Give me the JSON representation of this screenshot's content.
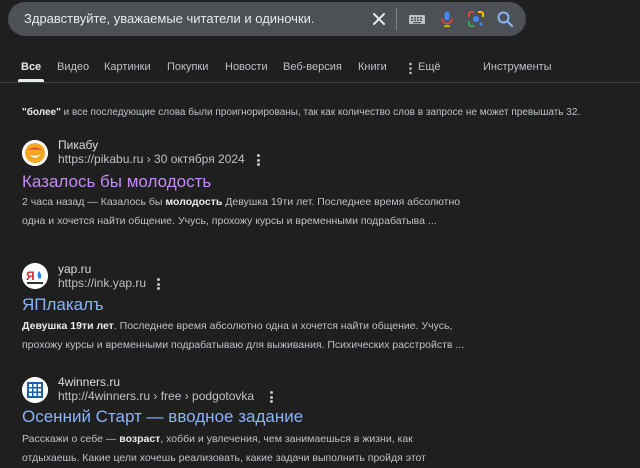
{
  "search": {
    "query": "Здравствуйте, уважаемые читатели и одиночки."
  },
  "icons": {
    "clear": "close-icon",
    "keyboard": "keyboard-icon",
    "mic": "microphone-icon",
    "lens": "lens-icon",
    "search": "search-icon"
  },
  "tabs": [
    {
      "label": "Все",
      "active": true
    },
    {
      "label": "Видео"
    },
    {
      "label": "Картинки"
    },
    {
      "label": "Покупки"
    },
    {
      "label": "Новости"
    },
    {
      "label": "Веб-версия"
    },
    {
      "label": "Книги"
    },
    {
      "label": "Ещё"
    },
    {
      "label": "Инструменты"
    }
  ],
  "notice": {
    "word": "\"более\"",
    "text": " и все последующие слова были проигнорированы, так как количество слов в запросе не может превышать 32."
  },
  "results": [
    {
      "site": "Пикабу",
      "url": "https://pikabu.ru › 30 октября 2024",
      "title": "Казалось бы молодость",
      "snippet_lines": [
        {
          "pre": "2 часа назад — Казалось бы ",
          "bold": "молодость",
          "post": " Девушка 19ти лет. Последнее время абсолютно"
        },
        {
          "pre": "одна и хочется найти общение. Учусь, прохожу курсы и временными подрабатыва ...",
          "bold": "",
          "post": ""
        }
      ]
    },
    {
      "site": "yap.ru",
      "url": "https://ink.yap.ru",
      "title": "ЯПлакалъ",
      "snippet_lines": [
        {
          "pre": "",
          "bold": "Девушка 19ти лет",
          "post": ". Последнее время абсолютно одна и хочется найти общение. Учусь,"
        },
        {
          "pre": "прохожу курсы и временными подрабатываю для выживания. Психических расстройств ...",
          "bold": "",
          "post": ""
        }
      ]
    },
    {
      "site": "4winners.ru",
      "url": "http://4winners.ru › free › podgotovka",
      "title": "Осенний Старт — вводное задание",
      "snippet_lines": [
        {
          "pre": "Расскажи о себе — ",
          "bold": "возраст",
          "post": ", хобби и увлечения, чем занимаешься в жизни, как"
        },
        {
          "pre": "отдыхаешь. Какие цели хочешь реализовать, какие задачи выполнить пройдя этот",
          "bold": "",
          "post": ""
        }
      ]
    }
  ],
  "colors": {
    "background": "#1f1f1f",
    "searchbar": "#4d5156",
    "visited_link": "#c58af9",
    "link": "#8ab4f8"
  }
}
